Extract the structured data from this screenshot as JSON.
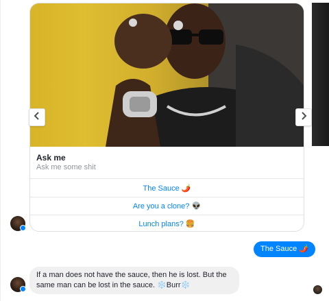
{
  "carousel": {
    "card": {
      "image_description": "man-raising-fist-with-watch",
      "title": "Ask me",
      "subtitle": "Ask me some shit",
      "buttons": [
        {
          "label": "The Sauce 🌶️"
        },
        {
          "label": "Are you a clone? 👽"
        },
        {
          "label": "Lunch plans? 🍔"
        }
      ]
    },
    "prev_icon": "chevron-left-icon",
    "next_icon": "chevron-right-icon"
  },
  "messages": {
    "outgoing": {
      "text": "The Sauce 🌶️"
    },
    "incoming": {
      "text": "If a man does not have the sauce, then he is lost. But the same man can be lost in the sauce. ❄️Burr❄️"
    }
  },
  "colors": {
    "accent": "#0084ff",
    "incoming_bubble": "#f1f0f0",
    "border": "#dddfe2"
  }
}
